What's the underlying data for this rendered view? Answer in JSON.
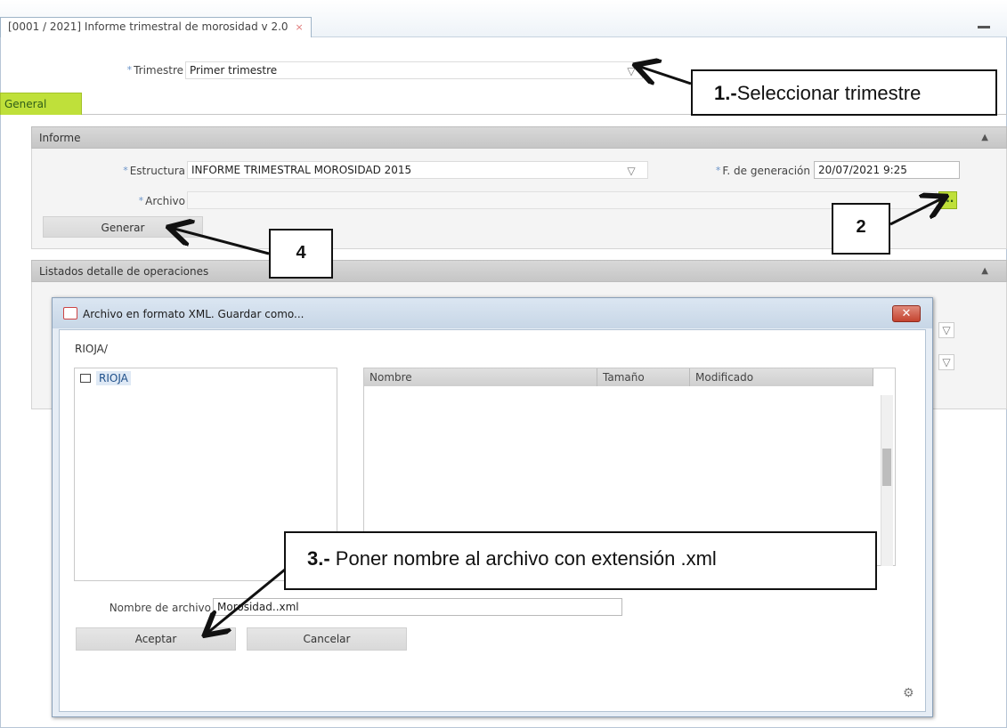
{
  "window": {
    "tab_title": "[0001 / 2021] Informe trimestral de morosidad v 2.0",
    "close_glyph": "×"
  },
  "trimestre": {
    "label": "Trimestre",
    "value": "Primer trimestre"
  },
  "tabs": {
    "general": "General"
  },
  "informe": {
    "header": "Informe",
    "estructura_label": "Estructura",
    "estructura_value": "INFORME TRIMESTRAL MOROSIDAD 2015",
    "fecha_label": "F. de generación",
    "fecha_value": "20/07/2021 9:25",
    "archivo_label": "Archivo",
    "archivo_value": "",
    "browse_label": "...",
    "generar_label": "Generar"
  },
  "listados": {
    "header": "Listados detalle de operaciones"
  },
  "dialog": {
    "title": "Archivo en formato XML. Guardar como...",
    "path": "RIOJA/",
    "tree_item": "RIOJA",
    "columns": [
      "Nombre",
      "Tamaño",
      "Modificado"
    ],
    "filename_label": "Nombre de archivo",
    "filename_value": "Morosidad..xml",
    "accept_label": "Aceptar",
    "cancel_label": "Cancelar",
    "close_glyph": "✕"
  },
  "callouts": {
    "c1_bold": "1.-",
    "c1_text": "Seleccionar trimestre",
    "c2": "2",
    "c3_bold": "3.-",
    "c3_text": " Poner nombre al archivo con extensión .xml",
    "c4": "4"
  },
  "colors": {
    "accent_green": "#bfe03a",
    "required_star": "#6a93c8",
    "dialog_close": "#c4432f"
  }
}
